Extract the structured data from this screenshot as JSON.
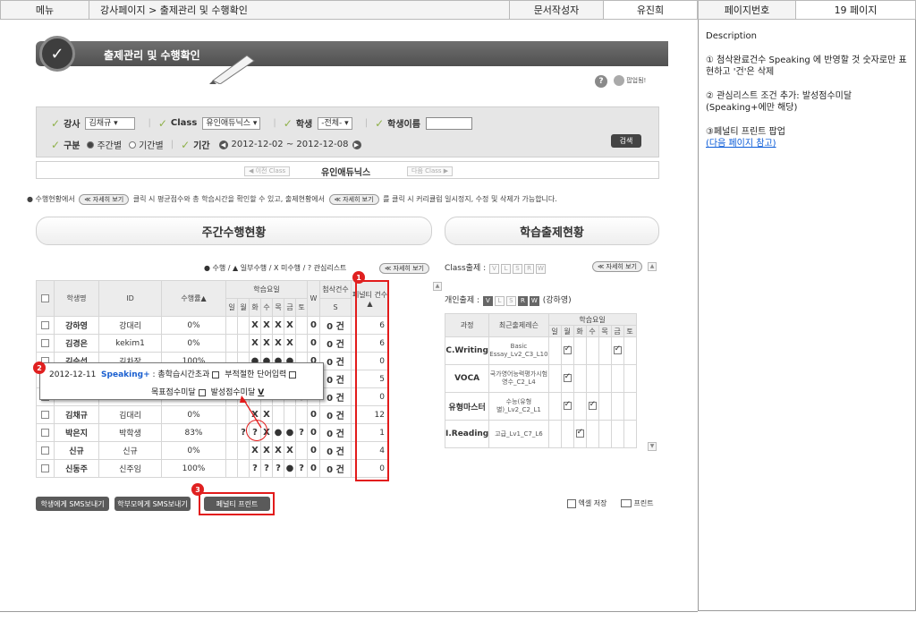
{
  "header": {
    "menu_label": "메뉴",
    "breadcrumb": "강사페이지 > 출제관리 및 수행확인",
    "author_label": "문서작성자",
    "author_name": "유진희",
    "page_no_label": "페이지번호",
    "page_no": "19 페이지"
  },
  "description": {
    "title": "Description",
    "items": [
      "① 첨삭완료건수 Speaking 에 반영할 것 숫자로만 표현하고 '건'은 삭제",
      "② 관심리스트 조건 추가: 발성점수미달(Speaking+에만 해당)",
      "③페널티 프린트 팝업"
    ],
    "link": "(다음 페이지 참고)"
  },
  "banner": {
    "title": "출제관리 및 수행확인",
    "help_label": "?",
    "help_text": "팝업됨!"
  },
  "filter": {
    "teacher_label": "강사",
    "teacher_value": "김채규",
    "class_label": "Class",
    "class_value": "유인애듀닉스",
    "grade_label": "학생",
    "grade_value": "-전체-",
    "student_label": "학생이름",
    "type_label": "구분",
    "weekly_label": "주간별",
    "period_opt_label": "기간별",
    "period_label": "기간",
    "period_value": "2012-12-02 ~ 2012-12-08",
    "search_btn": "검색"
  },
  "classbar": {
    "prev": "◀ 이전 Class",
    "current": "유인애듀닉스",
    "next": "다음 Class ▶"
  },
  "notice": {
    "part1": "수행현황에서",
    "btn": "≪ 자세히 보기",
    "part2": "클릭 시 평균점수와 총 학습시간을 확인할 수 있고, 출제현황에서",
    "part3": "를 클릭 시 커리큘럼 일시정지, 수정 및 삭제가 가능합니다."
  },
  "weekly": {
    "title": "주간수행현황",
    "legend": "● 수행 / ▲ 일부수행 / X 미수행 / ? 관심리스트",
    "detail_btn": "≪ 자세히 보기",
    "headers": {
      "name": "학생명",
      "id": "ID",
      "rate": "수행률▲",
      "days_title": "학습요일",
      "days": [
        "일",
        "월",
        "화",
        "수",
        "목",
        "금",
        "토"
      ],
      "w": "W",
      "edit_title": "첨삭건수",
      "s": "S",
      "penalty": "페널티 건수▲"
    },
    "rows": [
      {
        "name": "강하영",
        "id": "강대리",
        "rate": "0%",
        "marks": [
          "",
          "",
          "X",
          "X",
          "X",
          "X",
          ""
        ],
        "w": "0",
        "s": "0 건",
        "penalty": "6"
      },
      {
        "name": "김경은",
        "id": "kekim1",
        "rate": "0%",
        "marks": [
          "",
          "",
          "X",
          "X",
          "X",
          "X",
          ""
        ],
        "w": "0",
        "s": "0 건",
        "penalty": "6"
      },
      {
        "name": "김승섭",
        "id": "김차장",
        "rate": "100%",
        "marks": [
          "",
          "",
          "●",
          "●",
          "●",
          "●",
          ""
        ],
        "w": "0",
        "s": "0 건",
        "penalty": "0"
      },
      {
        "name": "",
        "id": "",
        "rate": "",
        "marks": [
          "",
          "",
          "",
          "",
          "",
          "",
          ""
        ],
        "w": "0",
        "s": "0 건",
        "penalty": "5"
      },
      {
        "name": "",
        "id": "",
        "rate": "",
        "marks": [
          "",
          "",
          "",
          "",
          "",
          "",
          "●"
        ],
        "w": "0",
        "s": "0 건",
        "penalty": "0"
      },
      {
        "name": "김채규",
        "id": "김대리",
        "rate": "0%",
        "marks": [
          "",
          "",
          "X",
          "X",
          "",
          "",
          ""
        ],
        "w": "0",
        "s": "0 건",
        "penalty": "12"
      },
      {
        "name": "박은지",
        "id": "박학생",
        "rate": "83%",
        "marks": [
          "",
          "?",
          "?",
          "X",
          "●",
          "●",
          "?"
        ],
        "w": "0",
        "s": "0 건",
        "penalty": "1"
      },
      {
        "name": "신규",
        "id": "신규",
        "rate": "0%",
        "marks": [
          "",
          "",
          "X",
          "X",
          "X",
          "X",
          ""
        ],
        "w": "0",
        "s": "0 건",
        "penalty": "4"
      },
      {
        "name": "신동주",
        "id": "신주임",
        "rate": "100%",
        "marks": [
          "",
          "",
          "?",
          "?",
          "?",
          "●",
          "?"
        ],
        "w": "0",
        "s": "0 건",
        "penalty": "0"
      }
    ]
  },
  "popup": {
    "date": "2012-12-11",
    "speaking": "Speaking+",
    "line1": ": 총학습시간초과",
    "opt1": "부적절한 단어입력",
    "opt2": "목표점수미달",
    "opt3": "발성점수미달",
    "checked": "V"
  },
  "study": {
    "title": "학습출제현황",
    "class_label": "Class출제 :",
    "letters": [
      "V",
      "L",
      "S",
      "R",
      "W"
    ],
    "detail_btn": "≪ 자세히 보기",
    "indiv_label": "개인출제 :",
    "indiv_name": "(강하영)",
    "headers": {
      "course": "과정",
      "recent": "최근출제레슨",
      "days_title": "학습요일",
      "days": [
        "일",
        "월",
        "화",
        "수",
        "목",
        "금",
        "토"
      ]
    },
    "rows": [
      {
        "course": "C.Writing",
        "recent": "Basic Essay_Lv2_C3_L10",
        "checks": [
          false,
          true,
          false,
          false,
          false,
          true,
          false
        ]
      },
      {
        "course": "VOCA",
        "recent": "국가영어능력평가시험영수_C2_L4",
        "checks": [
          false,
          true,
          false,
          false,
          false,
          false,
          false
        ]
      },
      {
        "course": "유형마스터",
        "recent": "수능(유형별)_Lv2_C2_L1",
        "checks": [
          false,
          true,
          false,
          true,
          false,
          false,
          false
        ]
      },
      {
        "course": "I.Reading",
        "recent": "고급_Lv1_C7_L6",
        "checks": [
          false,
          false,
          true,
          false,
          false,
          false,
          false
        ]
      }
    ]
  },
  "bottom": {
    "sms_student": "학생에게 SMS보내기",
    "sms_parent": "학부모에게 SMS보내기",
    "penalty_print": "페널티 프린트",
    "excel": "엑셀 저장",
    "print": "프린트"
  },
  "annotations": [
    "1",
    "2",
    "3"
  ],
  "colors": {
    "accent_red": "#e21b1b",
    "check_green": "#8fb14b",
    "link_blue": "#0a5bd8"
  }
}
